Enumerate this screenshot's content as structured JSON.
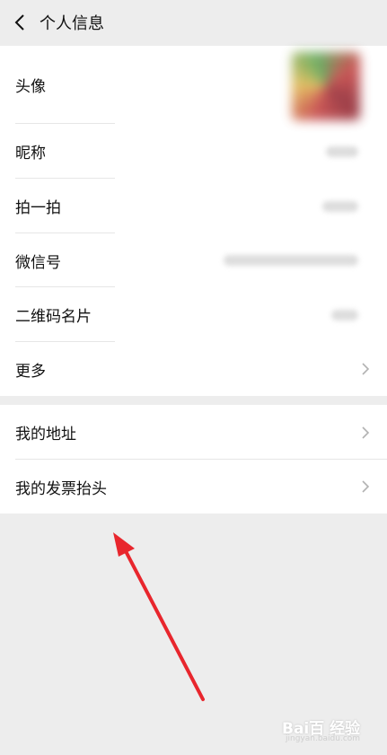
{
  "header": {
    "title": "个人信息"
  },
  "group1": {
    "items": [
      {
        "label": "头像"
      },
      {
        "label": "昵称"
      },
      {
        "label": "拍一拍"
      },
      {
        "label": "微信号"
      },
      {
        "label": "二维码名片"
      },
      {
        "label": "更多"
      }
    ]
  },
  "group2": {
    "items": [
      {
        "label": "我的地址"
      },
      {
        "label": "我的发票抬头"
      }
    ]
  },
  "watermark": {
    "brand": "Bai百 经验",
    "url": "jingyan.baidu.com"
  },
  "colors": {
    "page_bg": "#ededed",
    "card_bg": "#ffffff",
    "annotation_arrow": "#e8262d"
  }
}
